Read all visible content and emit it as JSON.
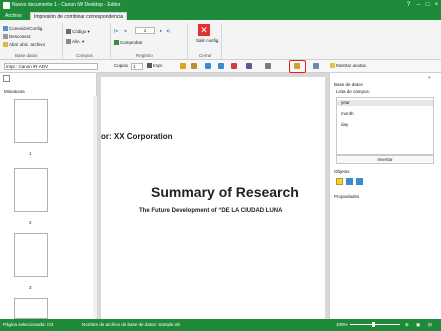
{
  "title": "Nuevo documento 1 - Canon iW Desktop - Editor",
  "tabs": [
    "Archivo",
    "Impresión de combinar correspondencia"
  ],
  "ribbon": {
    "base_datos": [
      "Conexión/Config.",
      "Desconect.",
      "Abrir ubic. archivo"
    ],
    "campos": [
      "Código",
      "Alin."
    ],
    "registro": {
      "page": "1",
      "comprobar": "Comprobar"
    },
    "cerrar": "Salir config.",
    "groups": [
      "Base datos",
      "Campos",
      "Registro",
      "Cerrar"
    ]
  },
  "toolbar": {
    "printer": "Impr.: Canon iR-ADV",
    "copies_label": "Copias",
    "copies": "1",
    "print_label": "Impr.",
    "show_annotations": "Mostrar anotac."
  },
  "left_pane": {
    "title": "Miniaturas",
    "thumbnails": [
      "1",
      "2",
      "3"
    ]
  },
  "document": {
    "org_line": "or: XX Corporation",
    "heading": "Summary of Research",
    "subheading": "The Future Development of “DE LA CIUDAD LUNA"
  },
  "right_pane": {
    "db_title": "Base de datos",
    "fields_label": "Lista de campos:",
    "fields": [
      "year",
      "month",
      "day"
    ],
    "insert_button": "Insertar",
    "objects_title": "Objetos",
    "properties_title": "Propiedades"
  },
  "status": {
    "page_selected": "Página seleccionada: /33",
    "db_file": "Nombre de archivo de base de datos: Sample.xls",
    "zoom": "100%"
  },
  "colors": {
    "accent": "#1f8a3a",
    "highlight": "#e02020"
  }
}
